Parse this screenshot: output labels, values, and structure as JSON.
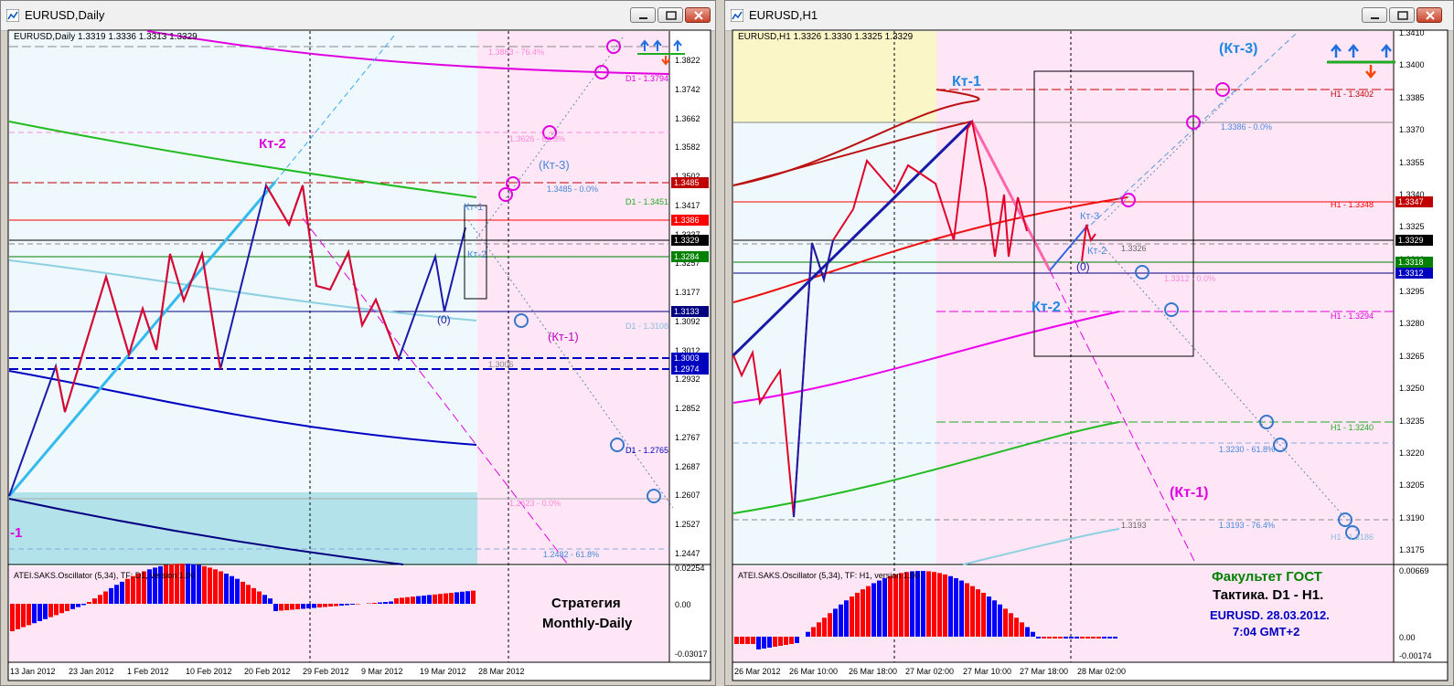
{
  "left": {
    "window_title": "EURUSD,Daily",
    "chart_header": "EURUSD,Daily  1.3319 1.3336 1.3313 1.3329",
    "price_ticks": [
      "1.3822",
      "1.3742",
      "1.3662",
      "1.3582",
      "1.3502",
      "1.3417",
      "1.3337",
      "1.3257",
      "1.3177",
      "1.3092",
      "1.3012",
      "1.2932",
      "1.2852",
      "1.2767",
      "1.2687",
      "1.2607",
      "1.2527",
      "1.2447"
    ],
    "price_tags": [
      {
        "text": "1.3485",
        "bg": "#c00000",
        "fg": "#ffffff"
      },
      {
        "text": "1.3386",
        "bg": "#ff0000",
        "fg": "#ffffff"
      },
      {
        "text": "1.3329",
        "bg": "#000000",
        "fg": "#ffffff"
      },
      {
        "text": "1.3284",
        "bg": "#008000",
        "fg": "#ffffff"
      },
      {
        "text": "1.3133",
        "bg": "#000080",
        "fg": "#ffffff"
      },
      {
        "text": "1.3003",
        "bg": "#0000c0",
        "fg": "#ffffff"
      },
      {
        "text": "1.2974",
        "bg": "#0000c0",
        "fg": "#ffffff"
      }
    ],
    "labels": {
      "kt2": "Кт-2",
      "kt3": "(Кт-3)",
      "kt1": "(Кт-1)",
      "kt1_small": "Кт-1",
      "kt2_small": "Кт-2",
      "zero": "(0)",
      "edge_minus1": "-1",
      "fib_7638": "1.3863 - 76.4%",
      "fib_d1_1379": "D1 - 1.3794",
      "fib_6180": "1.3626 - 61.8%",
      "fib_3485": "1.3485 - 0.0%",
      "fib_d1_1345": "D1 - 1.3451",
      "fib_d1_1310": "D1 - 1.3108",
      "fib_1300": "1.3006",
      "fib_d1_1276": "D1 - 1.2765",
      "fib_1262": "1.2623 - 0.0%",
      "fib_2482": "1.2482 - 61.8%"
    },
    "osc_title": "ATEI.SAKS.Oscillator (5,34), TF: D1, version 1.00",
    "osc_ticks": [
      "0.02254",
      "0.00",
      "-0.03017"
    ],
    "strategy_line1": "Стратегия",
    "strategy_line2": "Monthly-Daily",
    "time_ticks": [
      "13 Jan 2012",
      "23 Jan 2012",
      "1 Feb 2012",
      "10 Feb 2012",
      "20 Feb 2012",
      "29 Feb 2012",
      "9 Mar 2012",
      "19 Mar 2012",
      "28 Mar 2012"
    ]
  },
  "right": {
    "window_title": "EURUSD,H1",
    "chart_header": "EURUSD,H1  1.3326 1.3330 1.3325 1.3329",
    "price_ticks": [
      "1.3410",
      "1.3400",
      "1.3385",
      "1.3370",
      "1.3355",
      "1.3340",
      "1.3325",
      "1.3310",
      "1.3295",
      "1.3280",
      "1.3265",
      "1.3250",
      "1.3235",
      "1.3220",
      "1.3205",
      "1.3190",
      "1.3175"
    ],
    "price_tags": [
      {
        "text": "1.3347",
        "bg": "#c00000",
        "fg": "#ffffff"
      },
      {
        "text": "1.3329",
        "bg": "#000000",
        "fg": "#ffffff"
      },
      {
        "text": "1.3318",
        "bg": "#008000",
        "fg": "#ffffff"
      },
      {
        "text": "1.3312",
        "bg": "#0000c0",
        "fg": "#ffffff"
      }
    ],
    "labels": {
      "kt1": "Кт-1",
      "kt3": "(Кт-3)",
      "kt2": "Кт-2",
      "kt1p": "(Кт-1)",
      "kt3_small": "Кт-3",
      "kt2_small": "Кт-2",
      "zero": "(0)",
      "h1_1340": "H1 - 1.3402",
      "fib_1338": "1.3386 - 0.0%",
      "h1_1334": "H1 - 1.3348",
      "v_13326": "1.3326",
      "fib_13312": "1.3312 - 0.0%",
      "h1_1329": "H1 - 1.3294",
      "h1_1324": "H1 - 1.3240",
      "fib_13230": "1.3230 - 61.8%",
      "v_13193": "1.3193",
      "fib_13193": "1.3193 - 76.4%",
      "h1_1318": "H1 - 1.3186"
    },
    "osc_title": "ATEI.SAKS.Oscillator (5,34), TF: H1, version 1.00",
    "osc_ticks": [
      "0.00669",
      "0.00",
      "-0.00174"
    ],
    "faculty": "Факультет ГОСТ",
    "tactics": "Тактика. D1 - H1.",
    "date_line": "EURUSD.  28.03.2012.",
    "time_line": "7:04  GMT+2",
    "time_ticks": [
      "26 Mar 2012",
      "26 Mar 10:00",
      "26 Mar 18:00",
      "27 Mar 02:00",
      "27 Mar 10:00",
      "27 Mar 18:00",
      "28 Mar 02:00"
    ]
  },
  "colors": {
    "pink_zone": "#ffe6f6",
    "blue_zone": "#eef8fd",
    "yellow_zone": "#fbf6c8",
    "osc_red": "#ff0000",
    "osc_blue": "#0000ff"
  }
}
